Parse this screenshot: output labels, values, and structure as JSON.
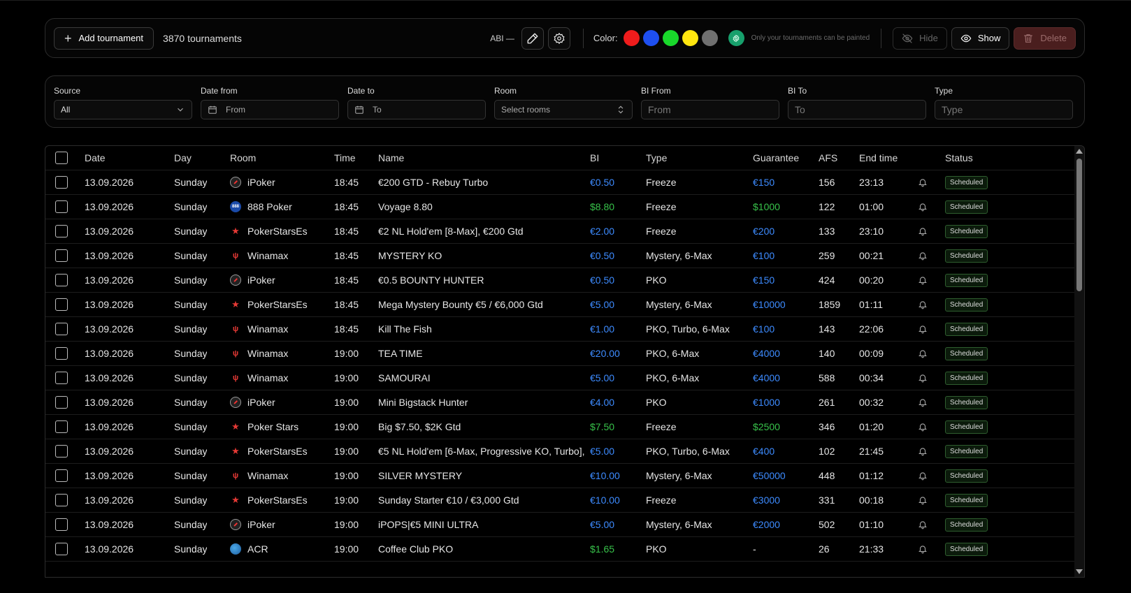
{
  "toolbar": {
    "add_label": "Add tournament",
    "count_text": "3870 tournaments",
    "abi_text": "ABI —",
    "color_label": "Color:",
    "colors": [
      "#ef1c1c",
      "#1e4ff0",
      "#19d82b",
      "#ffe60f",
      "#707070",
      "#17a06c"
    ],
    "paint_note": "Only your tournaments can be painted",
    "hide_label": "Hide",
    "show_label": "Show",
    "delete_label": "Delete"
  },
  "filters": {
    "source": {
      "label": "Source",
      "value": "All"
    },
    "date_from": {
      "label": "Date from",
      "placeholder": "From"
    },
    "date_to": {
      "label": "Date to",
      "placeholder": "To"
    },
    "room": {
      "label": "Room",
      "placeholder": "Select rooms"
    },
    "bi_from": {
      "label": "BI From",
      "placeholder": "From"
    },
    "bi_to": {
      "label": "BI To",
      "placeholder": "To"
    },
    "type": {
      "label": "Type",
      "placeholder": "Type"
    }
  },
  "table": {
    "headers": {
      "date": "Date",
      "day": "Day",
      "room": "Room",
      "time": "Time",
      "name": "Name",
      "bi": "BI",
      "type": "Type",
      "guarantee": "Guarantee",
      "afs": "AFS",
      "end": "End time",
      "status": "Status"
    },
    "rows": [
      {
        "date": "13.09.2026",
        "day": "Sunday",
        "room": "iPoker",
        "room_icon": "ipoker",
        "time": "18:45",
        "name": "€200 GTD - Rebuy Turbo",
        "bi": "€0.50",
        "type": "Freeze",
        "guarantee": "€150",
        "afs": "156",
        "end": "23:13",
        "status": "Scheduled"
      },
      {
        "date": "13.09.2026",
        "day": "Sunday",
        "room": "888 Poker",
        "room_icon": "888",
        "time": "18:45",
        "name": "Voyage 8.80",
        "bi": "$8.80",
        "type": "Freeze",
        "guarantee": "$1000",
        "afs": "122",
        "end": "01:00",
        "status": "Scheduled"
      },
      {
        "date": "13.09.2026",
        "day": "Sunday",
        "room": "PokerStarsEs",
        "room_icon": "stars",
        "time": "18:45",
        "name": "€2 NL Hold'em [8-Max], €200 Gtd",
        "bi": "€2.00",
        "type": "Freeze",
        "guarantee": "€200",
        "afs": "133",
        "end": "23:10",
        "status": "Scheduled"
      },
      {
        "date": "13.09.2026",
        "day": "Sunday",
        "room": "Winamax",
        "room_icon": "winamax",
        "time": "18:45",
        "name": "MYSTERY KO",
        "bi": "€0.50",
        "type": "Mystery, 6-Max",
        "guarantee": "€100",
        "afs": "259",
        "end": "00:21",
        "status": "Scheduled"
      },
      {
        "date": "13.09.2026",
        "day": "Sunday",
        "room": "iPoker",
        "room_icon": "ipoker",
        "time": "18:45",
        "name": "€0.5 BOUNTY HUNTER",
        "bi": "€0.50",
        "type": "PKO",
        "guarantee": "€150",
        "afs": "424",
        "end": "00:20",
        "status": "Scheduled"
      },
      {
        "date": "13.09.2026",
        "day": "Sunday",
        "room": "PokerStarsEs",
        "room_icon": "stars",
        "time": "18:45",
        "name": "Mega Mystery Bounty €5 / €6,000 Gtd",
        "bi": "€5.00",
        "type": "Mystery, 6-Max",
        "guarantee": "€10000",
        "afs": "1859",
        "end": "01:11",
        "status": "Scheduled"
      },
      {
        "date": "13.09.2026",
        "day": "Sunday",
        "room": "Winamax",
        "room_icon": "winamax",
        "time": "18:45",
        "name": "Kill The Fish",
        "bi": "€1.00",
        "type": "PKO, Turbo, 6-Max",
        "guarantee": "€100",
        "afs": "143",
        "end": "22:06",
        "status": "Scheduled"
      },
      {
        "date": "13.09.2026",
        "day": "Sunday",
        "room": "Winamax",
        "room_icon": "winamax",
        "time": "19:00",
        "name": "TEA TIME",
        "bi": "€20.00",
        "type": "PKO, 6-Max",
        "guarantee": "€4000",
        "afs": "140",
        "end": "00:09",
        "status": "Scheduled"
      },
      {
        "date": "13.09.2026",
        "day": "Sunday",
        "room": "Winamax",
        "room_icon": "winamax",
        "time": "19:00",
        "name": "SAMOURAI",
        "bi": "€5.00",
        "type": "PKO, 6-Max",
        "guarantee": "€4000",
        "afs": "588",
        "end": "00:34",
        "status": "Scheduled"
      },
      {
        "date": "13.09.2026",
        "day": "Sunday",
        "room": "iPoker",
        "room_icon": "ipoker",
        "time": "19:00",
        "name": "Mini Bigstack Hunter",
        "bi": "€4.00",
        "type": "PKO",
        "guarantee": "€1000",
        "afs": "261",
        "end": "00:32",
        "status": "Scheduled"
      },
      {
        "date": "13.09.2026",
        "day": "Sunday",
        "room": "Poker Stars",
        "room_icon": "stars",
        "time": "19:00",
        "name": "Big $7.50, $2K Gtd",
        "bi": "$7.50",
        "type": "Freeze",
        "guarantee": "$2500",
        "afs": "346",
        "end": "01:20",
        "status": "Scheduled"
      },
      {
        "date": "13.09.2026",
        "day": "Sunday",
        "room": "PokerStarsEs",
        "room_icon": "stars",
        "time": "19:00",
        "name": "€5 NL Hold'em [6-Max, Progressive KO, Turbo],...",
        "bi": "€5.00",
        "type": "PKO, Turbo, 6-Max",
        "guarantee": "€400",
        "afs": "102",
        "end": "21:45",
        "status": "Scheduled"
      },
      {
        "date": "13.09.2026",
        "day": "Sunday",
        "room": "Winamax",
        "room_icon": "winamax",
        "time": "19:00",
        "name": "SILVER MYSTERY",
        "bi": "€10.00",
        "type": "Mystery, 6-Max",
        "guarantee": "€50000",
        "afs": "448",
        "end": "01:12",
        "status": "Scheduled"
      },
      {
        "date": "13.09.2026",
        "day": "Sunday",
        "room": "PokerStarsEs",
        "room_icon": "stars",
        "time": "19:00",
        "name": "Sunday Starter €10 / €3,000 Gtd",
        "bi": "€10.00",
        "type": "Freeze",
        "guarantee": "€3000",
        "afs": "331",
        "end": "00:18",
        "status": "Scheduled"
      },
      {
        "date": "13.09.2026",
        "day": "Sunday",
        "room": "iPoker",
        "room_icon": "ipoker",
        "time": "19:00",
        "name": "iPOPS|€5 MINI ULTRA",
        "bi": "€5.00",
        "type": "Mystery, 6-Max",
        "guarantee": "€2000",
        "afs": "502",
        "end": "01:10",
        "status": "Scheduled"
      },
      {
        "date": "13.09.2026",
        "day": "Sunday",
        "room": "ACR",
        "room_icon": "acr",
        "time": "19:00",
        "name": "Coffee Club PKO",
        "bi": "$1.65",
        "type": "PKO",
        "guarantee": "-",
        "afs": "26",
        "end": "21:33",
        "status": "Scheduled"
      }
    ]
  }
}
